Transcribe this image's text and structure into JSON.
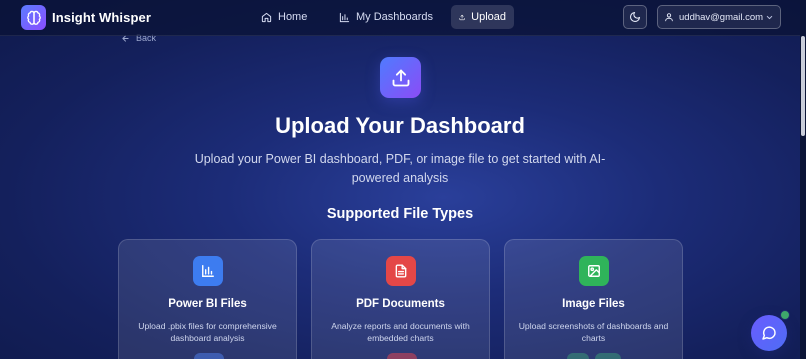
{
  "app": {
    "brand": "Insight Whisper"
  },
  "nav": {
    "home": "Home",
    "dashboards": "My Dashboards",
    "upload": "Upload"
  },
  "user": {
    "email": "uddhav@gmail.com"
  },
  "back": {
    "label": "Back"
  },
  "hero": {
    "title": "Upload Your Dashboard",
    "subtitle": "Upload your Power BI dashboard, PDF, or image file to get started with AI-powered analysis"
  },
  "section": {
    "title": "Supported File Types"
  },
  "cards": [
    {
      "title": "Power BI Files",
      "desc": "Upload .pbix files for comprehensive dashboard analysis",
      "icon": "bar-chart-icon",
      "color": "#3d7cf0"
    },
    {
      "title": "PDF Documents",
      "desc": "Analyze reports and documents with embedded charts",
      "icon": "document-icon",
      "color": "#e44747"
    },
    {
      "title": "Image Files",
      "desc": "Upload screenshots of dashboards and charts",
      "icon": "image-icon",
      "color": "#2fb45a"
    }
  ],
  "colors": {
    "accent": "#6a5cff",
    "background": "#1c2c78"
  }
}
